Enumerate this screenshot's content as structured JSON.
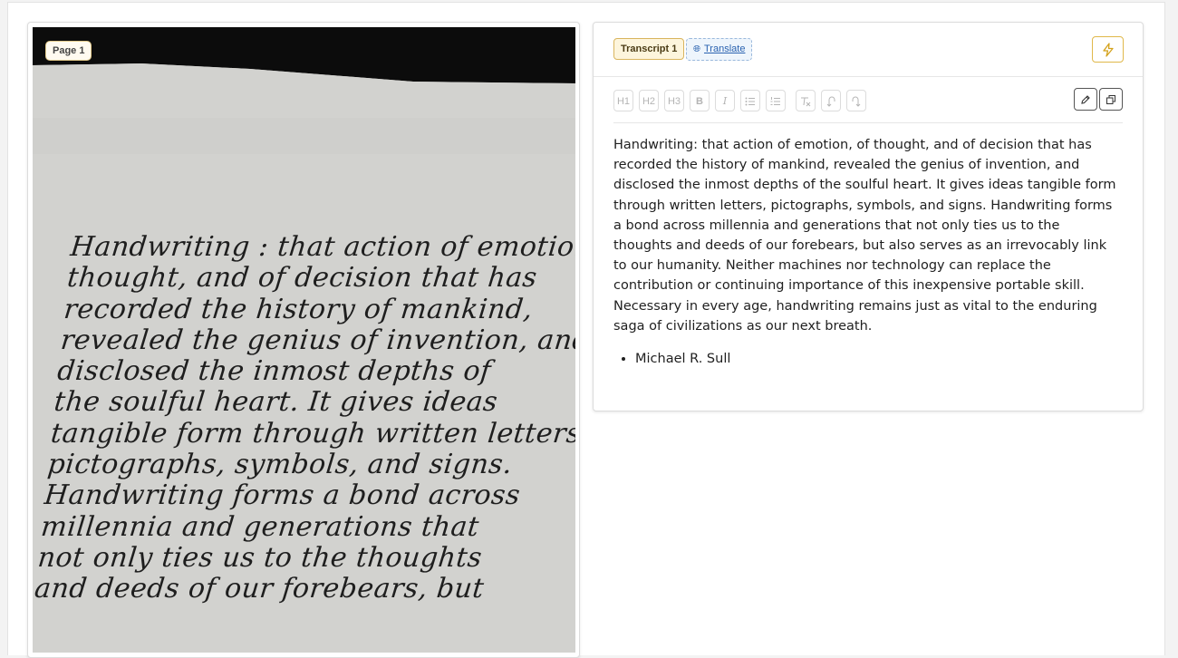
{
  "image_panel": {
    "page_label": "Page 1",
    "handwriting_lines": [
      "Handwriting : that action of emotion, of",
      "thought, and of decision that has",
      "recorded the history of mankind,",
      "revealed the genius of invention, and",
      "disclosed the inmost depths of",
      "the soulful heart. It gives ideas",
      "tangible form through written letters,",
      "pictographs, symbols, and signs.",
      "Handwriting forms a bond across",
      "millennia and generations that",
      "not only ties us to the thoughts",
      "and deeds of our forebears, but"
    ]
  },
  "transcript_panel": {
    "tab_label": "Transcript 1",
    "translate_label": "Translate",
    "toolbar": {
      "h1": "H1",
      "h2": "H2",
      "h3": "H3",
      "bold": "B",
      "italic": "I",
      "bullet_list_icon": "bullet-list-icon",
      "ordered_list_icon": "ordered-list-icon",
      "clear_format_icon": "clear-format-icon",
      "undo_icon": "undo-icon",
      "redo_icon": "redo-icon",
      "edit_icon": "pencil-icon",
      "copy_icon": "copy-icon"
    },
    "paragraph": "Handwriting: that action of emotion, of thought, and of decision that has recorded the history of mankind, revealed the genius of invention, and disclosed the inmost depths of the soulful heart. It gives ideas tangible form through written letters, pictographs, symbols, and signs. Handwriting forms a bond across millennia and generations that not only ties us to the thoughts and deeds of our forebears, but also serves as an irrevocably link to our humanity. Neither machines nor technology can replace the contribution or continuing importance of this inexpensive portable skill. Necessary in every age, handwriting remains just as vital to the enduring saga of civilizations as our next breath.",
    "bullets": [
      "Michael R. Sull"
    ]
  },
  "colors": {
    "accent_gold": "#d9b55e",
    "link_blue": "#2a62b0"
  }
}
